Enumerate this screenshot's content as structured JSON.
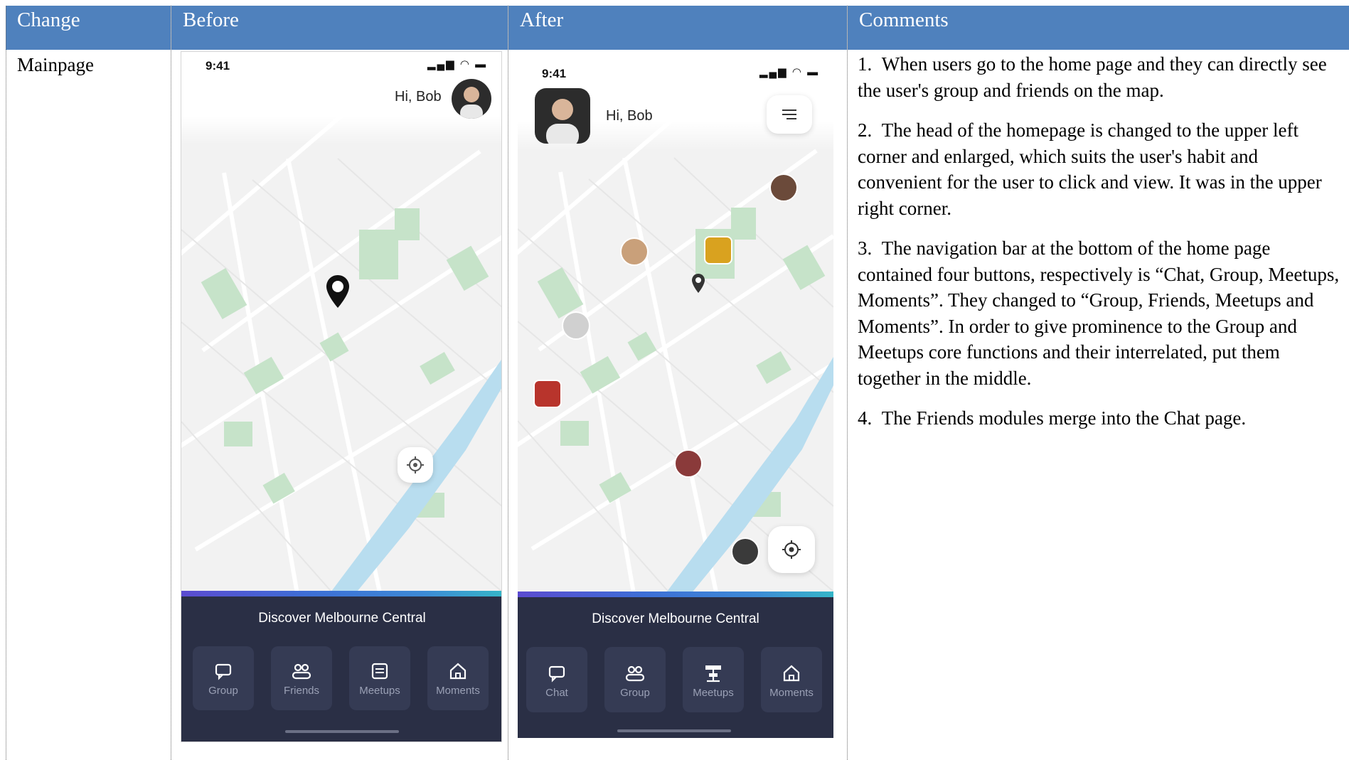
{
  "table": {
    "headers": [
      "Change",
      "Before",
      "After",
      "Comments"
    ],
    "row_label": "Mainpage"
  },
  "before": {
    "time": "9:41",
    "greeting": "Hi, Bob",
    "discover": "Discover Melbourne Central",
    "nav": [
      "Group",
      "Friends",
      "Meetups",
      "Moments"
    ]
  },
  "after": {
    "time": "9:41",
    "greeting": "Hi, Bob",
    "discover": "Discover Melbourne Central",
    "nav": [
      "Chat",
      "Group",
      "Meetups",
      "Moments"
    ]
  },
  "comments": [
    {
      "num": "1.",
      "text": "When users go to the home page and they can directly see the user's group and friends on the map."
    },
    {
      "num": "2.",
      "text": "The head of the homepage is changed to the upper left corner and enlarged, which suits the user's habit and convenient for the user to click and view. It was in the upper right corner."
    },
    {
      "num": "3.",
      "text": "The navigation bar at the bottom of the home page contained four buttons, respectively is “Chat, Group, Meetups, Moments”. They changed to “Group, Friends, Meetups and Moments”. In order to give prominence to the Group and Meetups core functions and their interrelated, put them together in the middle."
    },
    {
      "num": "4.",
      "text": "The Friends modules merge into the Chat page."
    }
  ],
  "colors": {
    "header_bg": "#4f81bd",
    "panel_bg": "#2a2f45",
    "map_bg": "#f4f4f4",
    "park": "#c6e3c9",
    "river": "#aed7ec"
  },
  "icons": [
    "signal-icon",
    "wifi-icon",
    "battery-icon",
    "chat-icon",
    "group-icon",
    "meetups-icon",
    "moments-icon",
    "locate-icon",
    "map-pin-icon",
    "menu-icon"
  ]
}
